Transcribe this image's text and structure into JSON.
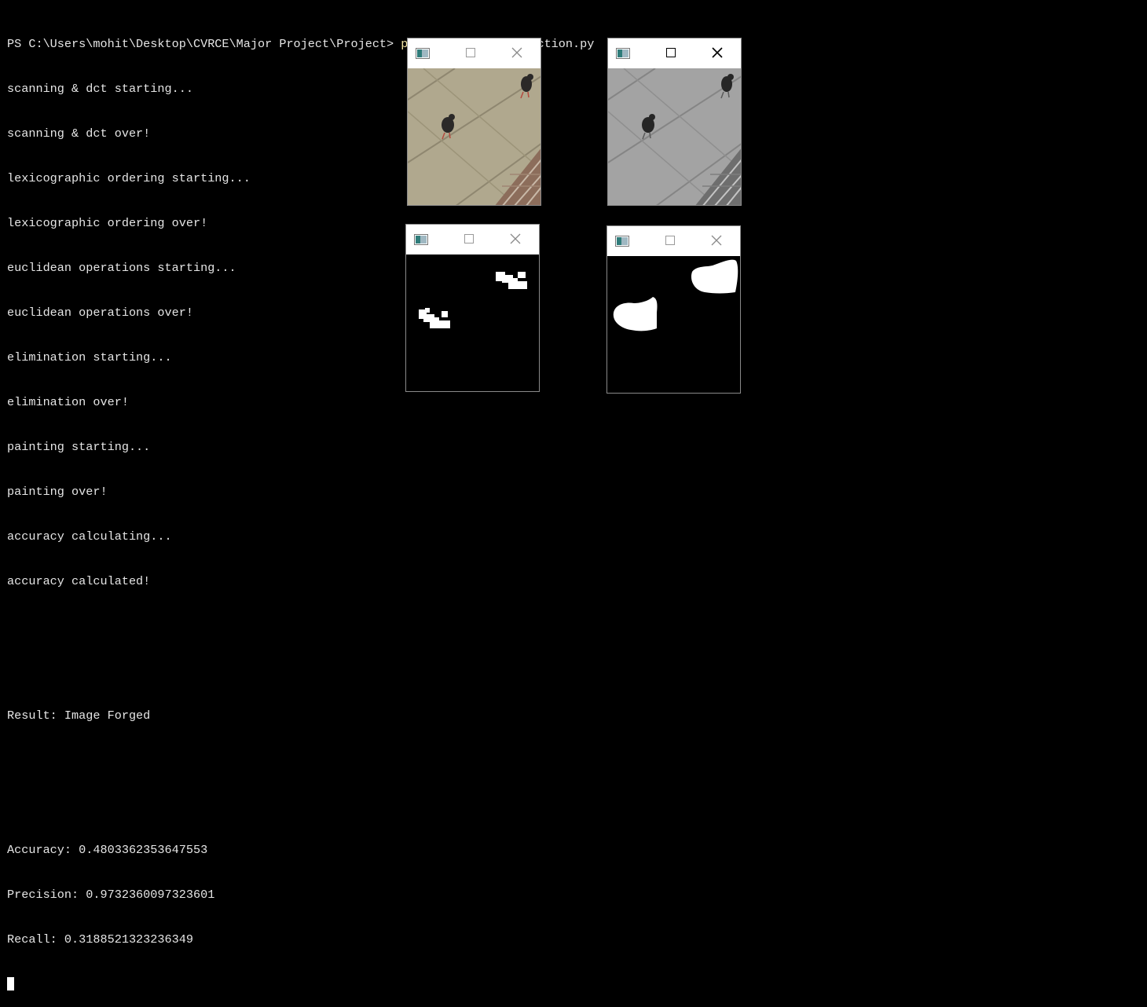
{
  "terminal": {
    "prompt_path": "PS C:\\Users\\mohit\\Desktop\\CVRCE\\Major Project\\Project> ",
    "command": "python",
    "argument": " forgery_detection.py",
    "lines": [
      "scanning & dct starting...",
      "scanning & dct over!",
      "lexicographic ordering starting...",
      "lexicographic ordering over!",
      "euclidean operations starting...",
      "euclidean operations over!",
      "elimination starting...",
      "elimination over!",
      "painting starting...",
      "painting over!",
      "accuracy calculating...",
      "accuracy calculated!",
      "",
      "",
      "Result: Image Forged",
      "",
      "",
      "Accuracy: 0.4803362353647553",
      "Precision: 0.9732360097323601",
      "Recall: 0.3188521323236349"
    ]
  },
  "windows": [
    {
      "name": "original-image-window",
      "content": "color-photo",
      "active": false
    },
    {
      "name": "grayscale-image-window",
      "content": "grayscale-photo",
      "active": true
    },
    {
      "name": "detected-mask-window",
      "content": "detected-mask",
      "active": false
    },
    {
      "name": "ground-truth-mask-window",
      "content": "ground-truth-mask",
      "active": false
    }
  ],
  "colors": {
    "background": "#000000",
    "terminal_text": "#e6e6e6",
    "command_text": "#f2e5a4",
    "window_chrome": "#ffffff"
  }
}
